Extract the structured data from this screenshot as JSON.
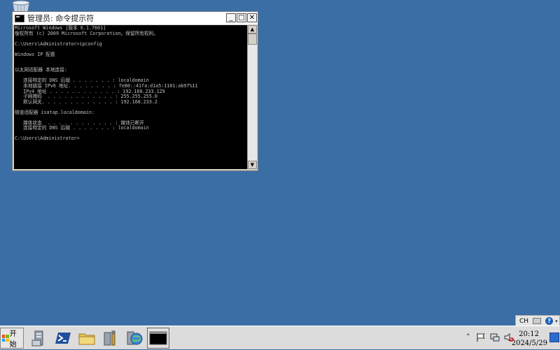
{
  "window": {
    "title": "管理员: 命令提示符",
    "controls": {
      "minimize": "_",
      "maximize": "□",
      "close": "✕"
    }
  },
  "console": {
    "lines": [
      "Microsoft Windows [版本 6.1.7601]",
      "版权所有 (c) 2009 Microsoft Corporation。保留所有权利。",
      "",
      "C:\\Users\\Administrator>ipconfig",
      "",
      "Windows IP 配置",
      "",
      "",
      "以太网适配器 本地连接:",
      "",
      "   连接特定的 DNS 后缀 . . . . . . . : localdomain",
      "   本地链接 IPv6 地址. . . . . . . . : fe80::41fa:d1a5:1101:ab97%11",
      "   IPv4 地址 . . . . . . . . . . . . : 192.168.233.129",
      "   子网掩码  . . . . . . . . . . . . : 255.255.255.0",
      "   默认网关. . . . . . . . . . . . . : 192.168.233.2",
      "",
      "隧道适配器 isatap.localdomain:",
      "",
      "   媒体状态  . . . . . . . . . . . . : 媒体已断开",
      "   连接特定的 DNS 后缀 . . . . . . . : localdomain",
      "",
      "C:\\Users\\Administrator>"
    ]
  },
  "taskbar": {
    "start_label": "开始",
    "items": [
      {
        "name": "server-manager",
        "icon": "server-manager-icon"
      },
      {
        "name": "powershell",
        "icon": "powershell-icon"
      },
      {
        "name": "explorer",
        "icon": "folder-icon"
      },
      {
        "name": "admin-tools",
        "icon": "tools-icon"
      },
      {
        "name": "network",
        "icon": "globe-icon"
      },
      {
        "name": "cmd",
        "icon": "cmd-icon",
        "active": true
      }
    ],
    "tray": {
      "expand": "˄",
      "time": "20:12",
      "date": "2024/5/29"
    }
  },
  "langbar": {
    "lang": "CH",
    "help": "?"
  },
  "colors": {
    "desktop": "#3a6ea5",
    "console_bg": "#000000",
    "console_fg": "#c0c0c0"
  }
}
